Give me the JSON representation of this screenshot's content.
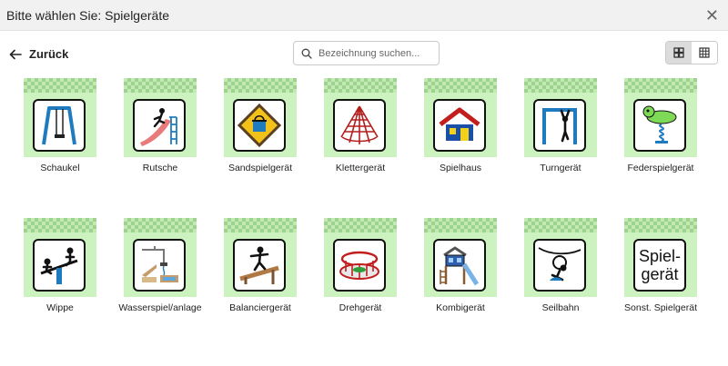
{
  "dialog": {
    "title": "Bitte wählen Sie: Spielgeräte",
    "close_icon": "close-icon"
  },
  "toolbar": {
    "back_label": "Zurück",
    "search_placeholder": "Bezeichnung suchen...",
    "search_value": "",
    "view_modes": [
      "grid-large",
      "grid-small"
    ],
    "active_view": "grid-large"
  },
  "items": [
    {
      "label": "Schaukel",
      "icon": "swing-icon"
    },
    {
      "label": "Rutsche",
      "icon": "slide-icon"
    },
    {
      "label": "Sandspielgerät",
      "icon": "sandbox-icon"
    },
    {
      "label": "Klettergerät",
      "icon": "climbing-net-icon"
    },
    {
      "label": "Spielhaus",
      "icon": "playhouse-icon"
    },
    {
      "label": "Turngerät",
      "icon": "gymnastics-bar-icon"
    },
    {
      "label": "Federspielgerät",
      "icon": "spring-rider-icon"
    },
    {
      "label": "Wippe",
      "icon": "seesaw-icon"
    },
    {
      "label": "Wasserspiel/anlage",
      "icon": "water-play-icon"
    },
    {
      "label": "Balanciergerät",
      "icon": "balance-beam-icon"
    },
    {
      "label": "Drehgerät",
      "icon": "carousel-icon"
    },
    {
      "label": "Kombigerät",
      "icon": "combination-unit-icon"
    },
    {
      "label": "Seilbahn",
      "icon": "zipline-icon"
    },
    {
      "label": "Sonst. Spielgerät",
      "icon": "other-equipment-icon",
      "sign_text": [
        "Spiel-",
        "gerät"
      ]
    }
  ],
  "colors": {
    "card_bg": "#ccf2c0",
    "card_check": "#9dd38e",
    "titlebar_bg": "#f1f1f1"
  }
}
